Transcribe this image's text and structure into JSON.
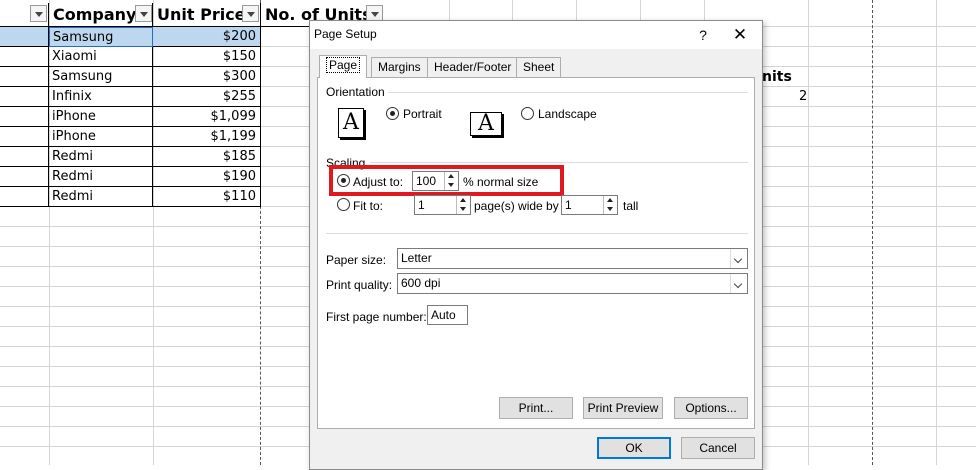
{
  "sheet": {
    "headers": [
      "Company",
      "Unit Price",
      "No. of Units"
    ],
    "rows": [
      {
        "company": "Samsung",
        "price": "$200"
      },
      {
        "company": "Xiaomi",
        "price": "$150"
      },
      {
        "company": "Samsung",
        "price": "$300"
      },
      {
        "company": "Infinix",
        "price": "$255"
      },
      {
        "company": "iPhone",
        "price": "$1,099"
      },
      {
        "company": "iPhone",
        "price": "$1,199"
      },
      {
        "company": "Redmi",
        "price": "$185"
      },
      {
        "company": "Redmi",
        "price": "$190"
      },
      {
        "company": "Redmi",
        "price": "$110"
      }
    ],
    "partial_header": "nits",
    "partial_value": "2"
  },
  "dialog": {
    "title": "Page Setup",
    "help": "?",
    "close": "✕",
    "tabs": [
      "Page",
      "Margins",
      "Header/Footer",
      "Sheet"
    ],
    "orientation": {
      "label": "Orientation",
      "portrait": "Portrait",
      "landscape": "Landscape",
      "selected": "portrait",
      "icon_glyph": "A"
    },
    "scaling": {
      "label": "Scaling",
      "adjust_to": "Adjust to:",
      "adjust_value": "100",
      "normal_size": "% normal size",
      "fit_to": "Fit to:",
      "fit_wide": "1",
      "pages_wide_by": "page(s) wide by",
      "fit_tall": "1",
      "tall": "tall",
      "selected": "adjust"
    },
    "paper_size": {
      "label": "Paper size:",
      "value": "Letter"
    },
    "print_quality": {
      "label": "Print quality:",
      "value": "600 dpi"
    },
    "first_page": {
      "label": "First page number:",
      "value": "Auto"
    },
    "buttons": {
      "print": "Print...",
      "preview": "Print Preview",
      "options": "Options...",
      "ok": "OK",
      "cancel": "Cancel"
    },
    "colors": {
      "highlight": "#e0181f",
      "default_button": "#0078d7",
      "selection": "#bdd7ee"
    }
  }
}
